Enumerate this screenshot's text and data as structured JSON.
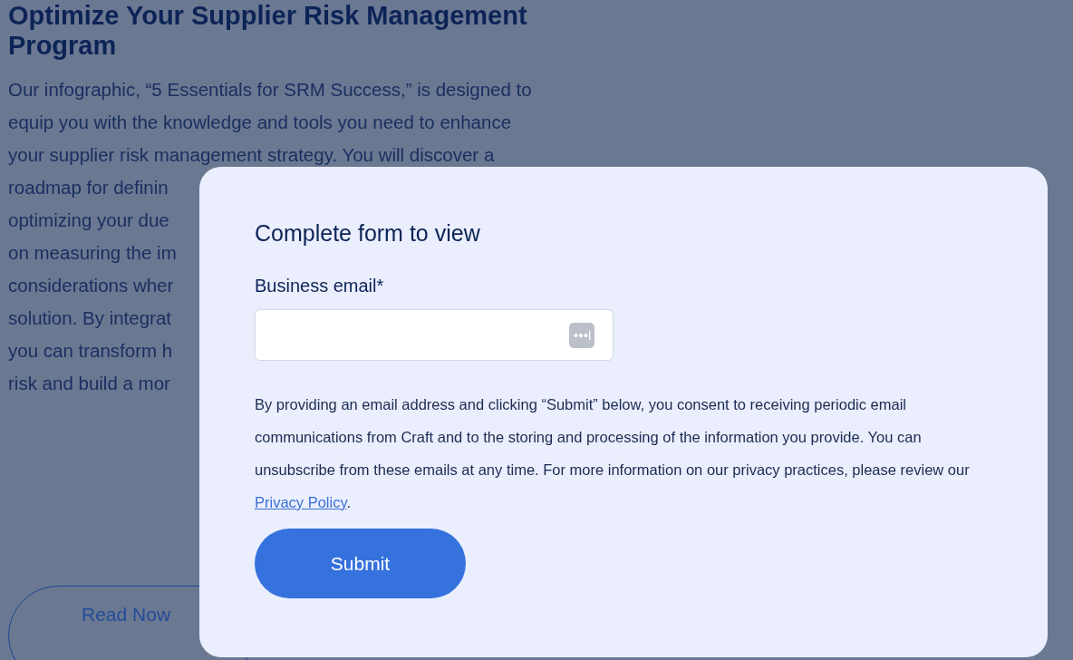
{
  "page": {
    "title": "Optimize Your Supplier Risk Management Program",
    "intro_lines": [
      "Our infographic, “5 Essentials for SRM Success,” is designed to",
      "equip you with the knowledge and tools you need to enhance",
      "your supplier risk management strategy. You will discover a",
      "roadmap for definin",
      "optimizing your due",
      "on measuring the im",
      "considerations wher",
      "solution. By integrat",
      "you can transform h",
      "risk and build a mor"
    ],
    "read_button": "Read Now"
  },
  "modal": {
    "title": "Complete form to view",
    "field": {
      "label": "Business email*"
    },
    "consent": {
      "before": "By providing an email address and clicking “Submit” below, you consent to receiving periodic email communications from Craft and to the storing and processing of the information you provide. You can unsubscribe from these emails at any time. For more information on our privacy practices, please review our ",
      "link": "Privacy Policy",
      "after": "."
    },
    "submit": "Submit"
  }
}
